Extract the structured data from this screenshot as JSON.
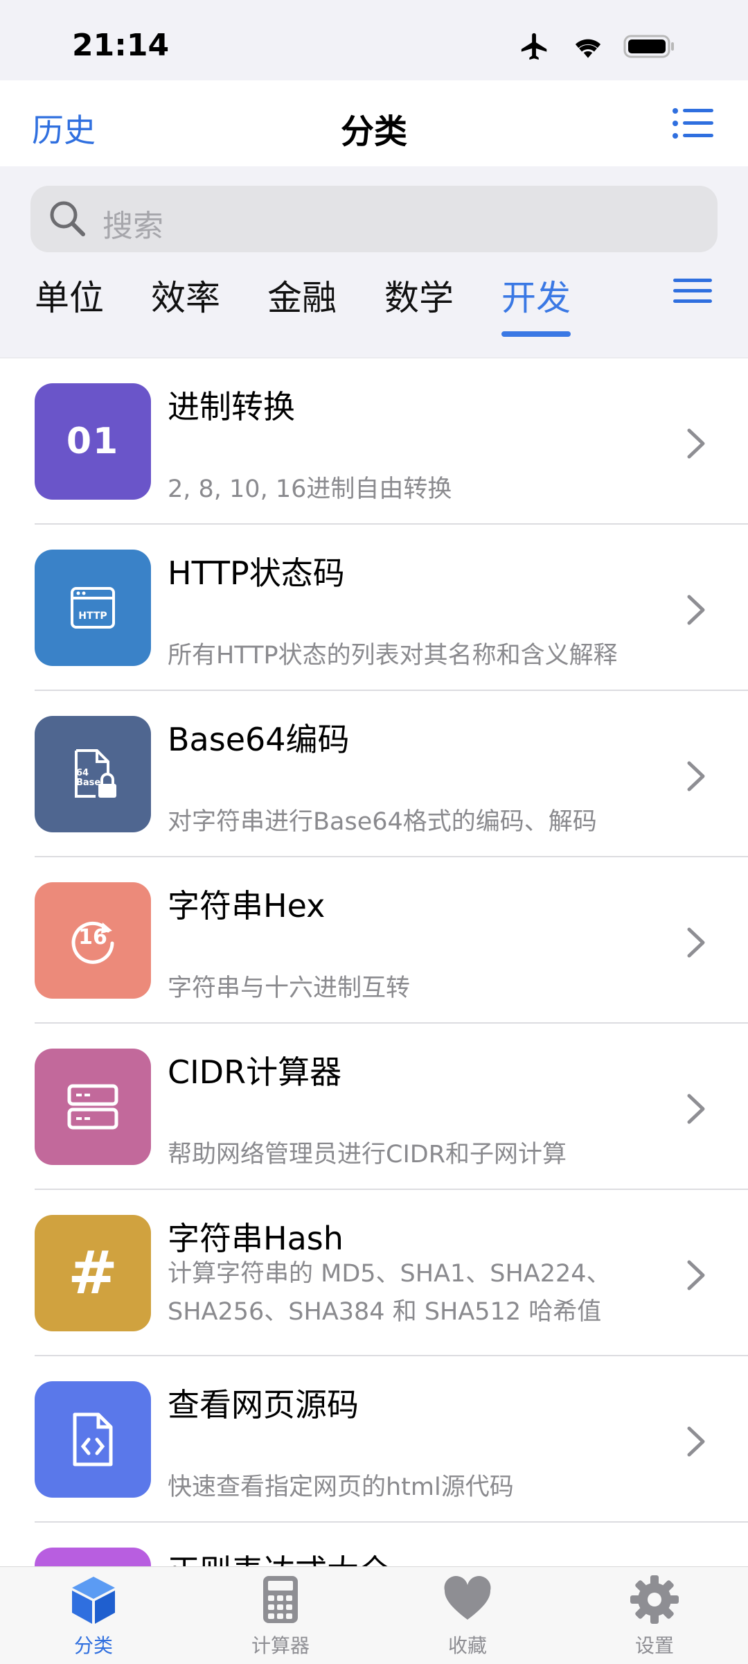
{
  "status": {
    "time": "21:14",
    "icons": [
      "airplane-icon",
      "wifi-icon",
      "battery-icon"
    ]
  },
  "nav": {
    "left": "历史",
    "title": "分类",
    "right_icon": "list-icon"
  },
  "search": {
    "placeholder": "搜索"
  },
  "tabs": [
    {
      "label": "单位"
    },
    {
      "label": "效率"
    },
    {
      "label": "金融"
    },
    {
      "label": "数学"
    },
    {
      "label": "开发",
      "active": true
    }
  ],
  "items": [
    {
      "title": "进制转换",
      "subtitle": "2, 8, 10, 16进制自由转换",
      "icon": "binary-01-icon",
      "icon_text": "01",
      "color": "#6a55c9"
    },
    {
      "title": "HTTP状态码",
      "subtitle": "所有HTTP状态的列表对其名称和含义解释",
      "icon": "http-window-icon",
      "icon_text": "HTTP",
      "color": "#3a82c8"
    },
    {
      "title": "Base64编码",
      "subtitle": "对字符串进行Base64格式的编码、解码",
      "icon": "base64-file-lock-icon",
      "icon_text": "64 Base",
      "color": "#4f6690"
    },
    {
      "title": "字符串Hex",
      "subtitle": "字符串与十六进制互转",
      "icon": "hex-16-icon",
      "icon_text": "16",
      "color": "#ec8a7a"
    },
    {
      "title": "CIDR计算器",
      "subtitle": "帮助网络管理员进行CIDR和子网计算",
      "icon": "server-icon",
      "color": "#c2699b"
    },
    {
      "title": "字符串Hash",
      "subtitle": "计算字符串的 MD5、SHA1、SHA224、SHA256、SHA384 和 SHA512 哈希值",
      "icon": "hash-icon",
      "icon_text": "#",
      "color": "#d0a23f"
    },
    {
      "title": "查看网页源码",
      "subtitle": "快速查看指定网页的html源代码",
      "icon": "code-file-icon",
      "color": "#5a78ea"
    },
    {
      "title": "正则表达式大全",
      "subtitle": "",
      "icon": "regex-icon",
      "color": "#b85ee0"
    }
  ],
  "tabbar": [
    {
      "label": "分类",
      "icon": "cube-icon",
      "active": true
    },
    {
      "label": "计算器",
      "icon": "calculator-icon"
    },
    {
      "label": "收藏",
      "icon": "heart-icon"
    },
    {
      "label": "设置",
      "icon": "gear-icon"
    }
  ]
}
